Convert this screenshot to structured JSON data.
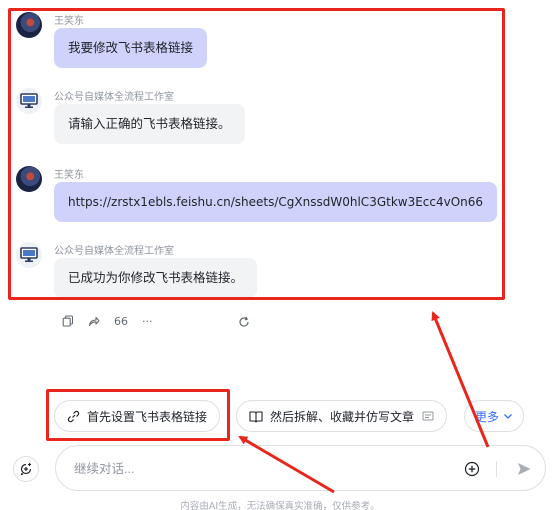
{
  "messages": [
    {
      "role": "user",
      "sender": "王笑东",
      "text": "我要修改飞书表格链接"
    },
    {
      "role": "bot",
      "sender": "公众号自媒体全流程工作室",
      "text": "请输入正确的飞书表格链接。"
    },
    {
      "role": "user",
      "sender": "王笑东",
      "text": "https://zrstx1ebls.feishu.cn/sheets/CgXnssdW0hlC3Gtkw3Ecc4vOn66"
    },
    {
      "role": "bot",
      "sender": "公众号自媒体全流程工作室",
      "text": "已成功为你修改飞书表格链接。"
    }
  ],
  "actions": {
    "like_count": "66",
    "more": "···"
  },
  "suggestions": [
    {
      "label": "首先设置飞书表格链接",
      "icon": "link-icon"
    },
    {
      "label": "然后拆解、收藏并仿写文章",
      "icon": "book-icon"
    }
  ],
  "more_label": "更多",
  "input": {
    "placeholder": "继续对话...",
    "value": ""
  },
  "disclaimer": "内容由AI生成，无法确保真实准确，仅供参考。",
  "annotation_color": "#e8261c",
  "accent_color": "#3370ff"
}
